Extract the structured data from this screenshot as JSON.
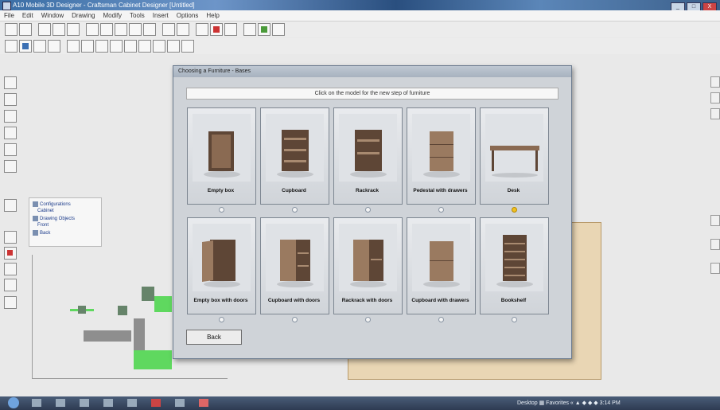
{
  "window": {
    "title": "A10 Mobile 3D Designer - Craftsman Cabinet Designer [Untitled]",
    "controls": [
      "_",
      "□",
      "X"
    ]
  },
  "menu": [
    "File",
    "Edit",
    "Window",
    "Drawing",
    "Modify",
    "Tools",
    "Insert",
    "Options",
    "Help"
  ],
  "tree": {
    "items": [
      "Configurations",
      "Cabinet",
      "Drawing Objects",
      "Front",
      "Back"
    ]
  },
  "dialog": {
    "title": "Choosing a Furniture - Bases",
    "instruction": "Click on the model for the new step of furniture",
    "cards": [
      {
        "label": "Empty box",
        "shape": "box",
        "selected": false
      },
      {
        "label": "Cupboard",
        "shape": "shelves",
        "selected": false
      },
      {
        "label": "Rackrack",
        "shape": "shelves",
        "selected": false
      },
      {
        "label": "Pedestal with drawers",
        "shape": "drawers",
        "selected": false
      },
      {
        "label": "Desk",
        "shape": "desk",
        "selected": true
      },
      {
        "label": "Empty box with doors",
        "shape": "door",
        "selected": false
      },
      {
        "label": "Cupboard with doors",
        "shape": "door-shelves",
        "selected": false
      },
      {
        "label": "Rackrack with doors",
        "shape": "door-shelves",
        "selected": false
      },
      {
        "label": "Cupboard with drawers",
        "shape": "drawers",
        "selected": false
      },
      {
        "label": "Bookshelf",
        "shape": "bookshelf",
        "selected": false
      }
    ],
    "back_label": "Back"
  },
  "taskbar": {
    "tray": "Desktop  ▦ Favorites  « ▲ ◆ ◆  ◆ 3:14 PM"
  },
  "colors": {
    "wood": "#8a6a52",
    "wood_dark": "#5e4636",
    "green": "#5fd85f",
    "accent": "#3a6ea5"
  }
}
